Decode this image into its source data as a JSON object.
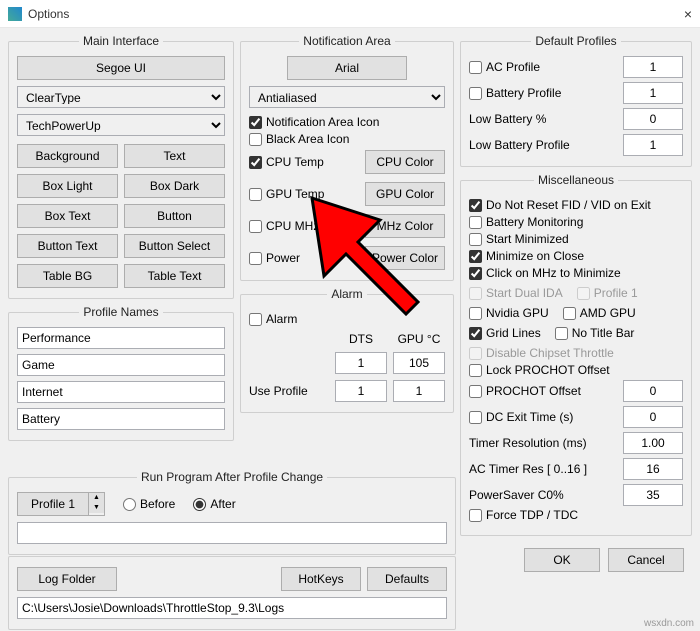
{
  "window": {
    "title": "Options",
    "close": "×"
  },
  "main_interface": {
    "legend": "Main Interface",
    "font_button": "Segoe UI",
    "render_mode": "ClearType",
    "theme": "TechPowerUp",
    "buttons": {
      "background": "Background",
      "text": "Text",
      "box_light": "Box Light",
      "box_dark": "Box Dark",
      "box_text": "Box Text",
      "button": "Button",
      "button_text": "Button Text",
      "button_select": "Button Select",
      "table_bg": "Table BG",
      "table_text": "Table Text"
    }
  },
  "profile_names": {
    "legend": "Profile Names",
    "p1": "Performance",
    "p2": "Game",
    "p3": "Internet",
    "p4": "Battery"
  },
  "notification": {
    "legend": "Notification Area",
    "font_button": "Arial",
    "aa": "Antialiased",
    "icon": "Notification Area Icon",
    "black": "Black Area Icon",
    "cpu_temp": "CPU Temp",
    "cpu_color": "CPU Color",
    "gpu_temp": "GPU Temp",
    "gpu_color": "GPU Color",
    "cpu_mhz": "CPU MHz",
    "mhz_color": "MHz Color",
    "power": "Power",
    "power_color": "Power Color"
  },
  "alarm": {
    "legend": "Alarm",
    "alarm": "Alarm",
    "dts": "DTS",
    "gpu": "GPU °C",
    "dts_val": "1",
    "gpu_val": "105",
    "use_profile": "Use Profile",
    "up1": "1",
    "up2": "1"
  },
  "run_after": {
    "legend": "Run Program After Profile Change",
    "profile": "Profile 1",
    "before": "Before",
    "after": "After",
    "path": ""
  },
  "bottom": {
    "log_folder": "Log Folder",
    "hotkeys": "HotKeys",
    "defaults": "Defaults",
    "path": "C:\\Users\\Josie\\Downloads\\ThrottleStop_9.3\\Logs"
  },
  "defaults": {
    "legend": "Default Profiles",
    "ac": "AC Profile",
    "ac_v": "1",
    "bat": "Battery Profile",
    "bat_v": "1",
    "lowpct": "Low Battery %",
    "lowpct_v": "0",
    "lowprof": "Low Battery Profile",
    "lowprof_v": "1"
  },
  "misc": {
    "legend": "Miscellaneous",
    "no_reset": "Do Not Reset FID / VID on Exit",
    "batmon": "Battery Monitoring",
    "startmin": "Start Minimized",
    "minclose": "Minimize on Close",
    "clickmhz": "Click on MHz to Minimize",
    "dualida": "Start Dual IDA",
    "prof1": "Profile 1",
    "nvidia": "Nvidia GPU",
    "amd": "AMD GPU",
    "grid": "Grid Lines",
    "notitle": "No Title Bar",
    "chipset": "Disable Chipset Throttle",
    "lockpro": "Lock PROCHOT Offset",
    "prooff": "PROCHOT Offset",
    "prooff_v": "0",
    "dcexit": "DC Exit Time (s)",
    "dcexit_v": "0",
    "timer": "Timer Resolution (ms)",
    "timer_v": "1.00",
    "actimer": "AC Timer Res [ 0..16 ]",
    "actimer_v": "16",
    "psaver": "PowerSaver C0%",
    "psaver_v": "35",
    "forcetdp": "Force TDP / TDC"
  },
  "dialog": {
    "ok": "OK",
    "cancel": "Cancel"
  },
  "footer": "wsxdn.com"
}
